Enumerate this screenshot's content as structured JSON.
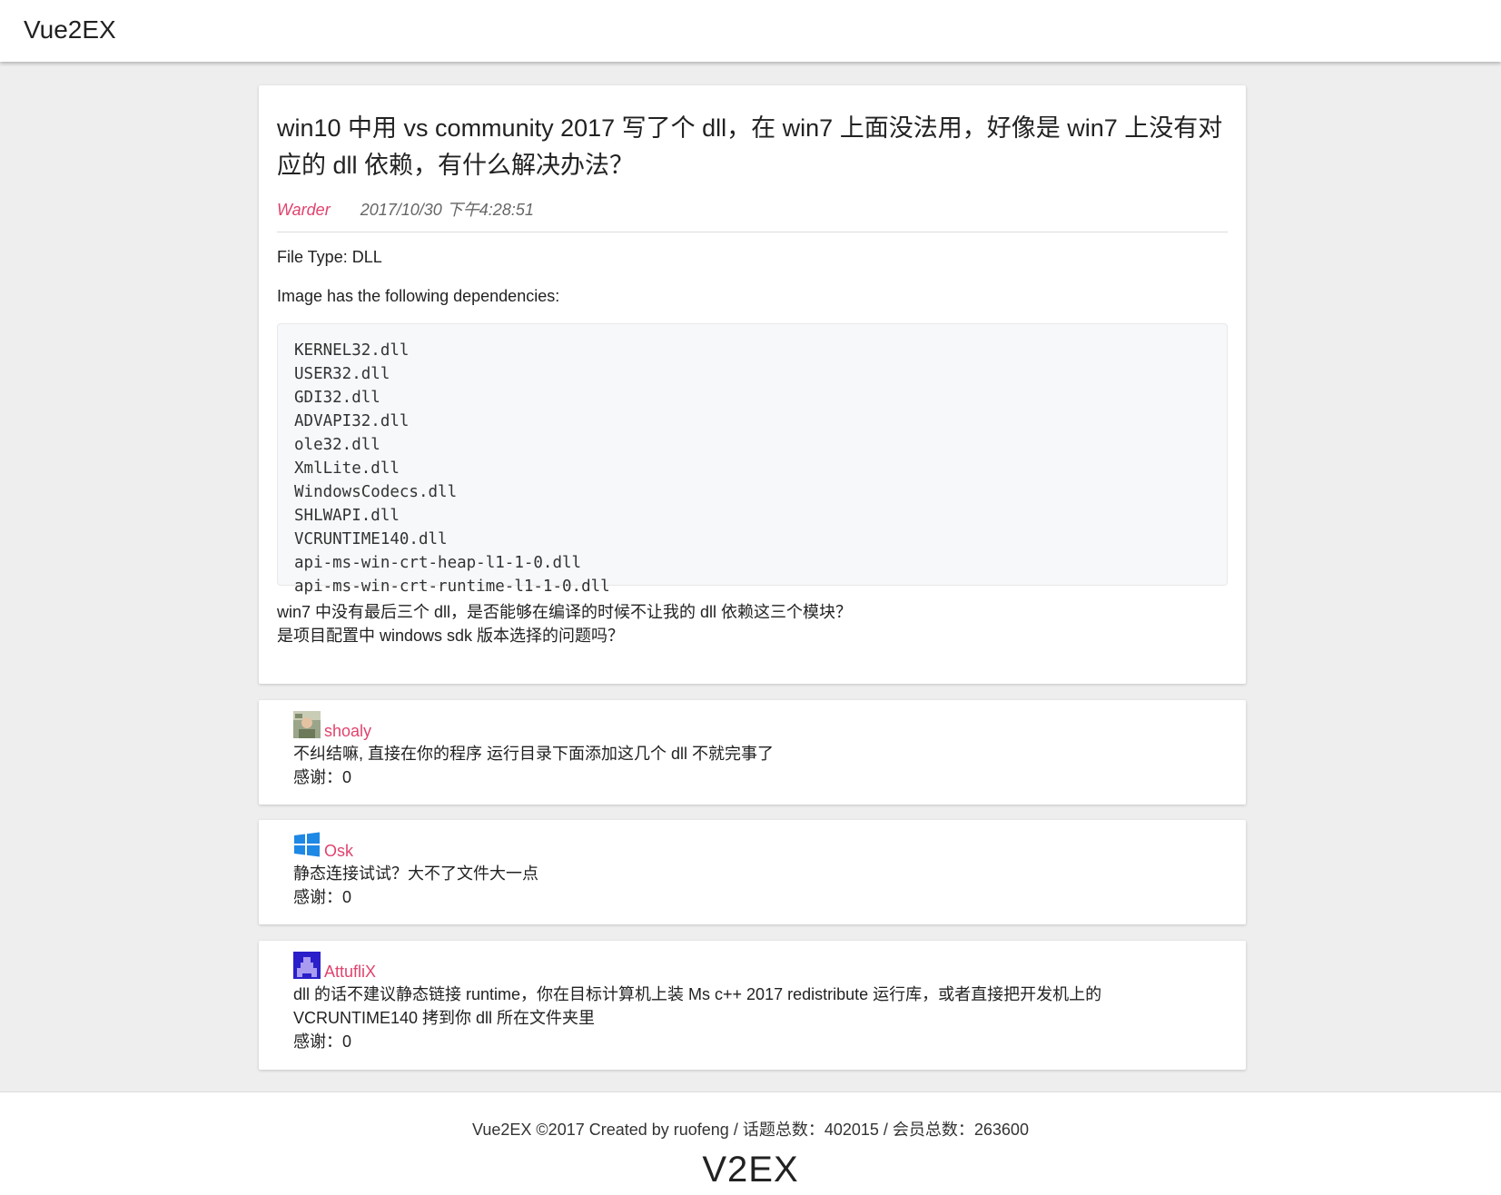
{
  "header": {
    "brand": "Vue2EX"
  },
  "topic": {
    "title": "win10 中用 vs community 2017 写了个 dll，在 win7 上面没法用，好像是 win7 上没有对应的 dll 依赖，有什么解决办法？",
    "author": "Warder",
    "time": "2017/10/30 下午4:28:51",
    "para1": "File Type: DLL",
    "para2": "Image has the following dependencies:",
    "code": "KERNEL32.dll\nUSER32.dll\nGDI32.dll\nADVAPI32.dll\nole32.dll\nXmlLite.dll\nWindowsCodecs.dll\nSHLWAPI.dll\nVCRUNTIME140.dll\napi-ms-win-crt-heap-l1-1-0.dll\napi-ms-win-crt-runtime-l1-1-0.dll",
    "para3_line1": "win7 中没有最后三个 dll，是否能够在编译的时候不让我的 dll 依赖这三个模块？",
    "para3_line2": "是项目配置中 windows sdk 版本选择的问题吗？"
  },
  "replies": [
    {
      "user": "shoaly",
      "avatar": "photo-avatar",
      "content": "不纠结嘛, 直接在你的程序 运行目录下面添加这几个 dll 不就完事了",
      "thanks": "感谢：0"
    },
    {
      "user": "Osk",
      "avatar": "windows-logo-avatar",
      "content": "静态连接试试？大不了文件大一点",
      "thanks": "感谢：0"
    },
    {
      "user": "AttufliX",
      "avatar": "pixel-avatar",
      "content": "dll 的话不建议静态链接 runtime，你在目标计算机上装 Ms c++ 2017 redistribute 运行库，或者直接把开发机上的 VCRUNTIME140 拷到你 dll 所在文件夹里",
      "thanks": "感谢：0"
    }
  ],
  "footer": {
    "text": "Vue2EX ©2017 Created by ruofeng / 话题总数：402015 / 会员总数：263600",
    "logo": "V2EX"
  },
  "colors": {
    "accent": "#e0436e",
    "background": "#eeeeee"
  }
}
